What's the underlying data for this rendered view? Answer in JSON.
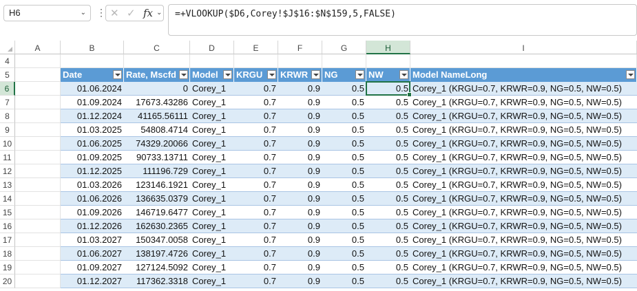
{
  "namebox": "H6",
  "formula": "=+VLOOKUP($D6,Corey!$J$16:$N$159,5,FALSE)",
  "columns": [
    "A",
    "B",
    "C",
    "D",
    "E",
    "F",
    "G",
    "H",
    "I"
  ],
  "rows_start": 4,
  "headers": [
    "Date",
    "Rate, Mscfd",
    "Model",
    "KRGU",
    "KRWR",
    "NG",
    "NW",
    "Model NameLong"
  ],
  "data": [
    [
      "01.06.2024",
      "0",
      "Corey_1",
      "0.7",
      "0.9",
      "0.5",
      "0.5",
      "Corey_1 (KRGU=0.7, KRWR=0.9, NG=0.5, NW=0.5)"
    ],
    [
      "01.09.2024",
      "17673.43286",
      "Corey_1",
      "0.7",
      "0.9",
      "0.5",
      "0.5",
      "Corey_1 (KRGU=0.7, KRWR=0.9, NG=0.5, NW=0.5)"
    ],
    [
      "01.12.2024",
      "41165.56111",
      "Corey_1",
      "0.7",
      "0.9",
      "0.5",
      "0.5",
      "Corey_1 (KRGU=0.7, KRWR=0.9, NG=0.5, NW=0.5)"
    ],
    [
      "01.03.2025",
      "54808.4714",
      "Corey_1",
      "0.7",
      "0.9",
      "0.5",
      "0.5",
      "Corey_1 (KRGU=0.7, KRWR=0.9, NG=0.5, NW=0.5)"
    ],
    [
      "01.06.2025",
      "74329.20066",
      "Corey_1",
      "0.7",
      "0.9",
      "0.5",
      "0.5",
      "Corey_1 (KRGU=0.7, KRWR=0.9, NG=0.5, NW=0.5)"
    ],
    [
      "01.09.2025",
      "90733.13711",
      "Corey_1",
      "0.7",
      "0.9",
      "0.5",
      "0.5",
      "Corey_1 (KRGU=0.7, KRWR=0.9, NG=0.5, NW=0.5)"
    ],
    [
      "01.12.2025",
      "111196.729",
      "Corey_1",
      "0.7",
      "0.9",
      "0.5",
      "0.5",
      "Corey_1 (KRGU=0.7, KRWR=0.9, NG=0.5, NW=0.5)"
    ],
    [
      "01.03.2026",
      "123146.1921",
      "Corey_1",
      "0.7",
      "0.9",
      "0.5",
      "0.5",
      "Corey_1 (KRGU=0.7, KRWR=0.9, NG=0.5, NW=0.5)"
    ],
    [
      "01.06.2026",
      "136635.0379",
      "Corey_1",
      "0.7",
      "0.9",
      "0.5",
      "0.5",
      "Corey_1 (KRGU=0.7, KRWR=0.9, NG=0.5, NW=0.5)"
    ],
    [
      "01.09.2026",
      "146719.6477",
      "Corey_1",
      "0.7",
      "0.9",
      "0.5",
      "0.5",
      "Corey_1 (KRGU=0.7, KRWR=0.9, NG=0.5, NW=0.5)"
    ],
    [
      "01.12.2026",
      "162630.2365",
      "Corey_1",
      "0.7",
      "0.9",
      "0.5",
      "0.5",
      "Corey_1 (KRGU=0.7, KRWR=0.9, NG=0.5, NW=0.5)"
    ],
    [
      "01.03.2027",
      "150347.0058",
      "Corey_1",
      "0.7",
      "0.9",
      "0.5",
      "0.5",
      "Corey_1 (KRGU=0.7, KRWR=0.9, NG=0.5, NW=0.5)"
    ],
    [
      "01.06.2027",
      "138197.4726",
      "Corey_1",
      "0.7",
      "0.9",
      "0.5",
      "0.5",
      "Corey_1 (KRGU=0.7, KRWR=0.9, NG=0.5, NW=0.5)"
    ],
    [
      "01.09.2027",
      "127124.5092",
      "Corey_1",
      "0.7",
      "0.9",
      "0.5",
      "0.5",
      "Corey_1 (KRGU=0.7, KRWR=0.9, NG=0.5, NW=0.5)"
    ],
    [
      "01.12.2027",
      "117362.3318",
      "Corey_1",
      "0.7",
      "0.9",
      "0.5",
      "0.5",
      "Corey_1 (KRGU=0.7, KRWR=0.9, NG=0.5, NW=0.5)"
    ]
  ],
  "icons": {
    "cancel": "close-icon",
    "enter": "check-icon",
    "function": "fx-icon"
  },
  "colors": {
    "header_fill": "#5b9bd5",
    "band_fill": "#ddebf7",
    "selection": "#217346"
  }
}
